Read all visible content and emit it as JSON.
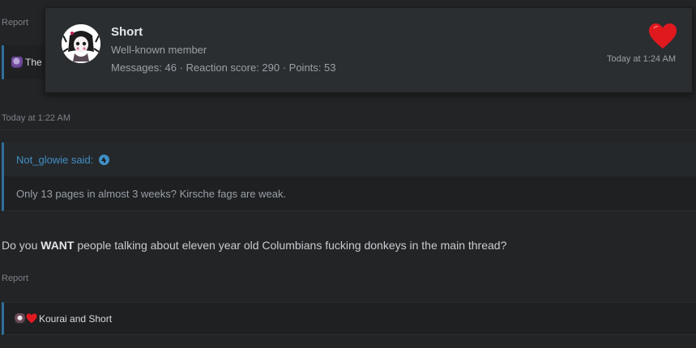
{
  "top_post": {
    "report_label": "Report",
    "reaction_text": "The"
  },
  "tooltip": {
    "name": "Short",
    "user_title": "Well-known member",
    "stats": "Messages: 46 · Reaction score: 290 · Points: 53",
    "reaction_time": "Today at 1:24 AM",
    "reaction_icon": "heart-icon",
    "heart_color": "#e0191f"
  },
  "post": {
    "timestamp": "Today at 1:22 AM",
    "quote": {
      "author_said": "Not_glowie said:",
      "body": "Only 13 pages in almost 3 weeks? Kirsche fags are weak."
    },
    "text_before": "Do you ",
    "text_bold": "WANT",
    "text_after": " people talking about eleven year old Columbians fucking donkeys in the main thread?",
    "report_label": "Report",
    "reactions_text": "Kourai and Short"
  },
  "colors": {
    "background": "#222426",
    "accent_link": "#3f8ec4",
    "quote_bar": "#2f6f9a"
  }
}
